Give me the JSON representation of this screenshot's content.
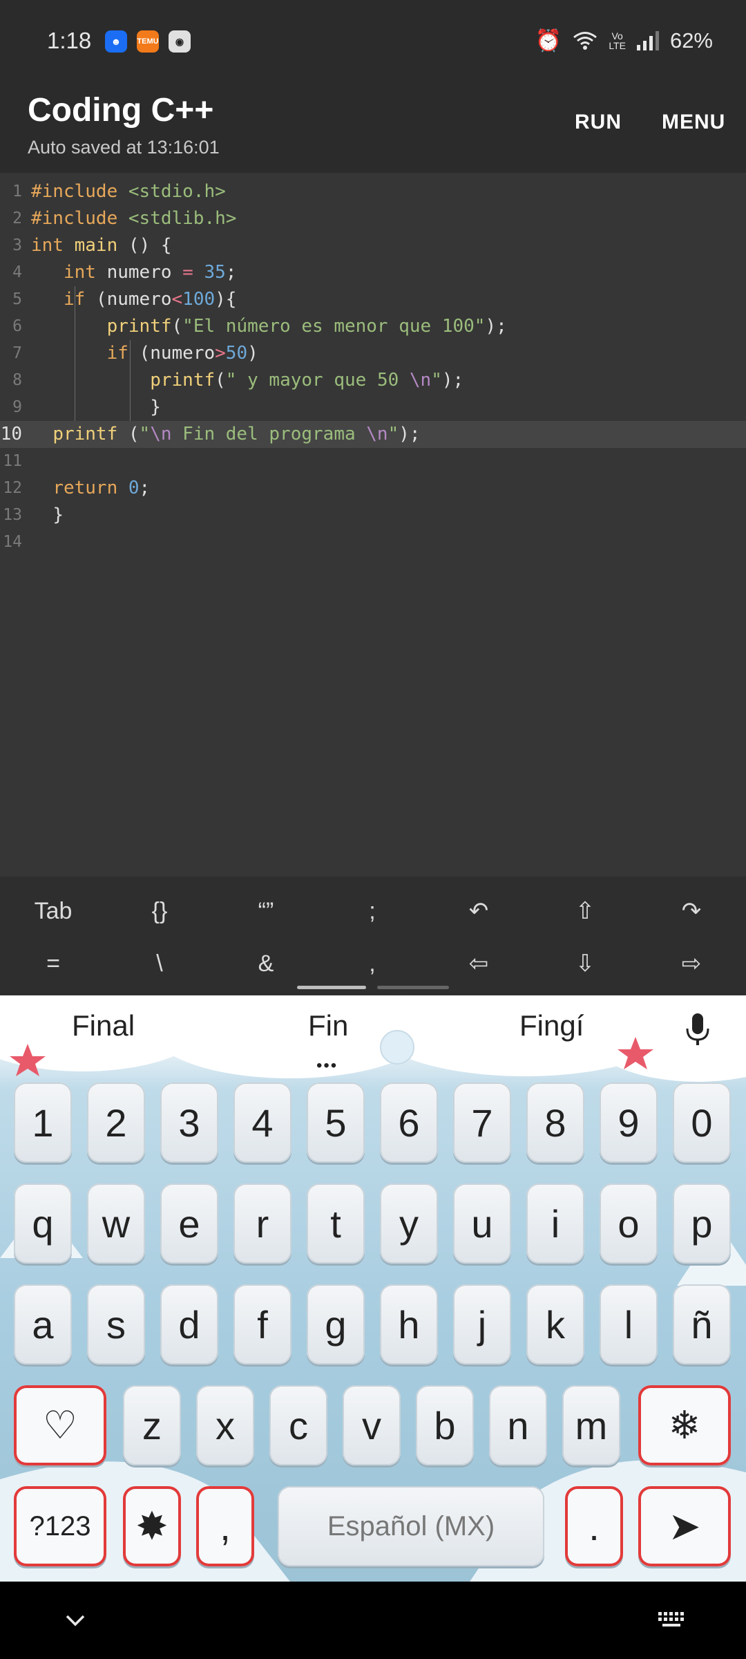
{
  "status_bar": {
    "time": "1:18",
    "battery": "62%",
    "icons": [
      "messenger-icon",
      "temu-icon",
      "camera-app-icon",
      "alarm-icon",
      "wifi-icon",
      "volte-icon",
      "signal-icon"
    ]
  },
  "app_bar": {
    "title": "Coding C++",
    "subtitle": "Auto saved at 13:16:01",
    "run_label": "RUN",
    "menu_label": "MENU"
  },
  "editor": {
    "active_line": 10,
    "lines": [
      {
        "num": "1",
        "text": "#include <stdio.h>"
      },
      {
        "num": "2",
        "text": "#include <stdlib.h>"
      },
      {
        "num": "3",
        "text": "int main () {"
      },
      {
        "num": "4",
        "text": "   int numero = 35;"
      },
      {
        "num": "5",
        "text": "   if (numero<100){"
      },
      {
        "num": "6",
        "text": "       printf(\"El número es menor que 100\");"
      },
      {
        "num": "7",
        "text": "       if (numero>50)"
      },
      {
        "num": "8",
        "text": "           printf(\" y mayor que 50 \\n\");"
      },
      {
        "num": "9",
        "text": "           }"
      },
      {
        "num": "10",
        "text": "  printf (\"\\n Fin del programa \\n\");"
      },
      {
        "num": "11",
        "text": ""
      },
      {
        "num": "12",
        "text": "  return 0;"
      },
      {
        "num": "13",
        "text": "  }"
      },
      {
        "num": "14",
        "text": ""
      }
    ]
  },
  "accessory": {
    "row1": [
      "Tab",
      "{}",
      "“”",
      ";",
      "↶",
      "⇧",
      "↷"
    ],
    "row2": [
      "=",
      "\\",
      "&",
      ",",
      "⇦",
      "⇩",
      "⇨"
    ],
    "row1_names": [
      "tab-key",
      "braces-key",
      "quotes-key",
      "semicolon-key",
      "undo-icon",
      "shift-up-icon",
      "redo-icon"
    ],
    "row2_names": [
      "equals-key",
      "backslash-key",
      "ampersand-key",
      "comma-key",
      "arrow-left-icon",
      "arrow-down-icon",
      "arrow-right-icon"
    ]
  },
  "keyboard": {
    "suggestions": [
      "Final",
      "Fin",
      "Fingí"
    ],
    "number_row": [
      "1",
      "2",
      "3",
      "4",
      "5",
      "6",
      "7",
      "8",
      "9",
      "0"
    ],
    "row1": [
      "q",
      "w",
      "e",
      "r",
      "t",
      "y",
      "u",
      "i",
      "o",
      "p"
    ],
    "row2": [
      "a",
      "s",
      "d",
      "f",
      "g",
      "h",
      "j",
      "k",
      "l",
      "ñ"
    ],
    "row3": [
      "z",
      "x",
      "c",
      "v",
      "b",
      "n",
      "m"
    ],
    "heart_key": "♡",
    "snowflake_key": "❄",
    "symbols_key": "?123",
    "star_key": "✸",
    "comma_key": ",",
    "space_label": "Español (MX)",
    "period_key": ".",
    "enter_key": "➤"
  },
  "nav_bar": {
    "icons": [
      "chevron-down-icon",
      "keyboard-icon"
    ]
  },
  "colors": {
    "background": "#2b2b2b",
    "editor_bg": "#363636",
    "keyword": "#e7a85a",
    "string": "#9bbd7c",
    "number": "#6ea9d9",
    "operator": "#e8768b",
    "function": "#f0d07a",
    "key_border_special": "#e23a3a"
  }
}
